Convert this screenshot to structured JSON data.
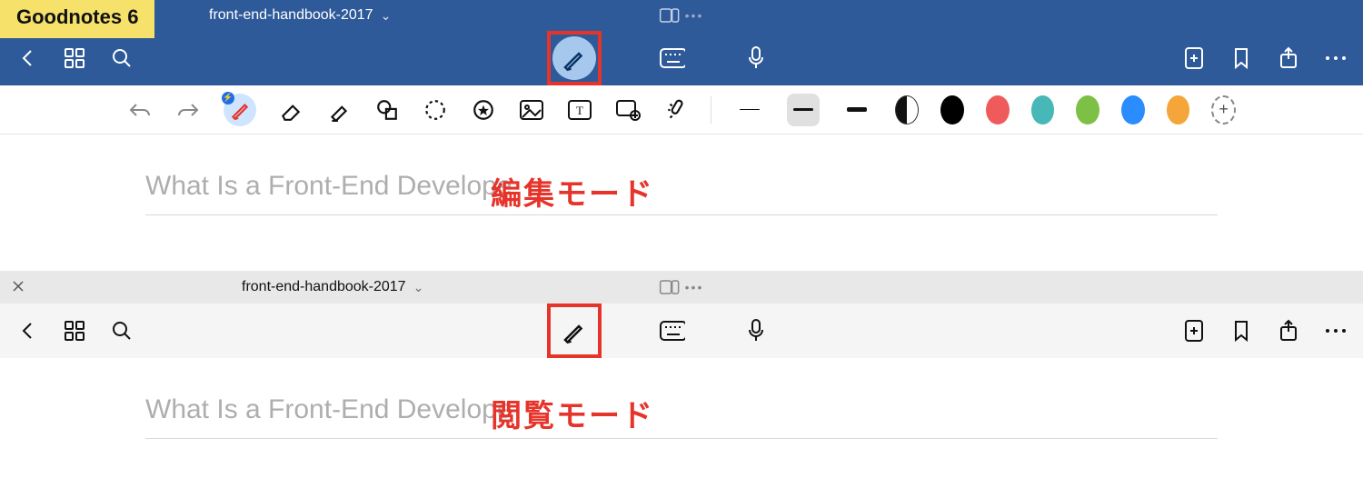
{
  "app_badge": "Goodnotes 6",
  "document_title": "front-end-handbook-2017",
  "heading_partial": "What Is a Front-End Develope",
  "labels": {
    "edit_mode": "編集モード",
    "view_mode": "閲覧モード"
  },
  "colors": {
    "header_blue": "#2e5a99",
    "highlight_red": "#e6342b",
    "pen_bubble": "#a6c8ed",
    "swatches": [
      "#000000",
      "#ef5b5b",
      "#48b7b7",
      "#7cc146",
      "#2a8cff",
      "#f4a63a"
    ]
  },
  "stroke_widths_px": [
    1,
    3,
    5
  ],
  "selected_stroke_index": 1,
  "icons": {
    "chevron_left": "chevron-left-icon",
    "grid": "grid-icon",
    "search": "search-icon",
    "pen": "pen-icon",
    "keyboard": "keyboard-icon",
    "mic": "mic-icon",
    "add_page": "add-page-icon",
    "bookmark": "bookmark-icon",
    "share": "share-icon",
    "more": "more-icon",
    "undo": "undo-icon",
    "redo": "redo-icon",
    "eraser": "eraser-icon",
    "highlighter": "highlighter-icon",
    "shape": "shape-icon",
    "lasso": "lasso-icon",
    "sticker": "sticker-icon",
    "image": "image-icon",
    "text": "text-icon",
    "media": "media-icon",
    "magic": "magic-icon",
    "split_swatch": "swatch-split-icon",
    "add_swatch": "add-color-icon",
    "multitask": "multitask-indicator-icon",
    "close": "close-icon",
    "chevron_down": "chevron-down-icon"
  }
}
